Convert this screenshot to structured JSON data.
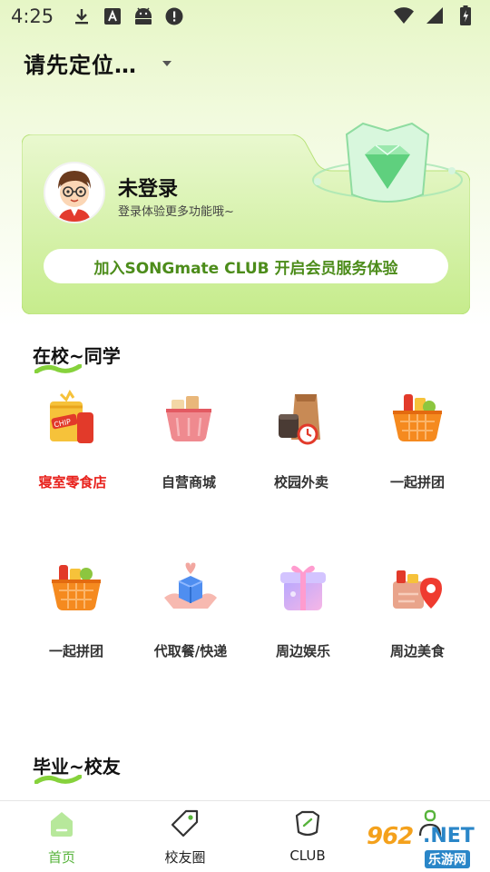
{
  "status_bar": {
    "time": "4:25"
  },
  "header": {
    "location": "请先定位…"
  },
  "member_card": {
    "title": "未登录",
    "subtitle": "登录体验更多功能哦~",
    "club_button": "加入SONGmate CLUB 开启会员服务体验"
  },
  "sections": {
    "campus": {
      "title": "在校~同学",
      "items": [
        {
          "label": "寝室零食店",
          "icon": "snack-bag-icon"
        },
        {
          "label": "自营商城",
          "icon": "shopping-basket-icon"
        },
        {
          "label": "校园外卖",
          "icon": "takeout-bag-icon"
        },
        {
          "label": "一起拼团",
          "icon": "group-buy-basket-icon"
        },
        {
          "label": "一起拼团",
          "icon": "group-buy-basket-icon"
        },
        {
          "label": "代取餐/快递",
          "icon": "delivery-box-icon"
        },
        {
          "label": "周边娱乐",
          "icon": "gift-box-icon"
        },
        {
          "label": "周边美食",
          "icon": "food-location-icon"
        }
      ]
    },
    "alumni": {
      "title": "毕业~校友"
    }
  },
  "bottom_nav": {
    "items": [
      {
        "label": "首页",
        "icon": "home-icon",
        "active": true
      },
      {
        "label": "校友圈",
        "icon": "tag-icon",
        "active": false
      },
      {
        "label": "CLUB",
        "icon": "club-icon",
        "active": false
      },
      {
        "label": "",
        "icon": "profile-icon",
        "active": false
      }
    ]
  },
  "watermark": {
    "number": "962",
    "net": ".NET",
    "text": "乐游网"
  },
  "colors": {
    "accent_green": "#56b33a",
    "card_green": "#c9ee93",
    "highlight_red": "#e8211c"
  }
}
